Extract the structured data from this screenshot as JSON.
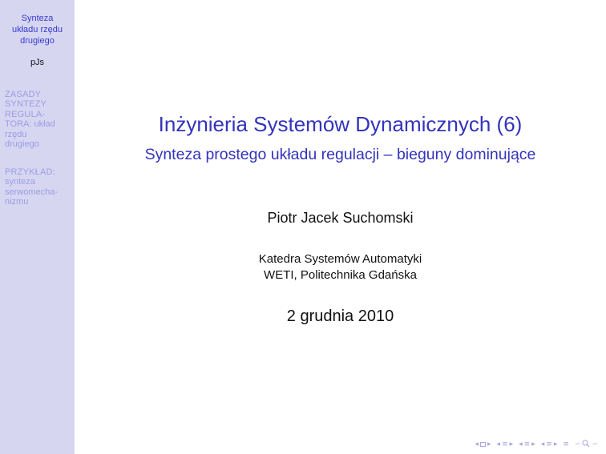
{
  "sidebar": {
    "title_lines": [
      "Synteza",
      "układu rzędu",
      "drugiego"
    ],
    "author": "pJs",
    "sections": [
      {
        "lines": [
          "ZASADY",
          "SYNTEZY",
          "REGULA-",
          "TORA: układ",
          "rzędu",
          "drugiego"
        ]
      },
      {
        "lines": [
          "PRZYKŁAD:",
          "synteza",
          "serwomecha-",
          "nizmu"
        ]
      }
    ]
  },
  "slide": {
    "title": "Inżynieria Systemów Dynamicznych (6)",
    "subtitle": "Synteza prostego układu regulacji – bieguny dominujące",
    "author": "Piotr Jacek Suchomski",
    "institute_line1": "Katedra Systemów Automatyki",
    "institute_line2": "WETI, Politechnika Gdańska",
    "date": "2 grudnia 2010"
  },
  "nav": {
    "left": "◂",
    "right": "▸",
    "align": "≡",
    "search": "∽",
    "color": "#a6a6d8"
  },
  "colors": {
    "sidebar_bg": "#d6d6f1",
    "title": "#3333bb",
    "sidebar_active": "#3a3ad0",
    "sidebar_inactive": "#9c9ce6"
  }
}
